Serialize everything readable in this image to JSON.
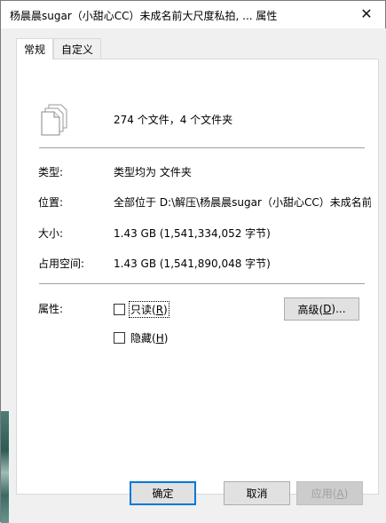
{
  "window": {
    "title": "杨晨晨sugar（小甜心CC）未成名前大尺度私拍, ... 属性",
    "close_symbol": "✕"
  },
  "tabs": [
    {
      "label": "常规",
      "active": true
    },
    {
      "label": "自定义",
      "active": false
    }
  ],
  "general": {
    "summary": "274 个文件，4 个文件夹",
    "type_label": "类型:",
    "type_value": "类型均为 文件夹",
    "location_label": "位置:",
    "location_value": "全部位于 D:\\解压\\杨晨晨sugar（小甜心CC）未成名前",
    "size_label": "大小:",
    "size_value": "1.43 GB (1,541,334,052 字节)",
    "disk_size_label": "占用空间:",
    "disk_size_value": "1.43 GB (1,541,890,048 字节)",
    "attributes_label": "属性:",
    "readonly": {
      "label_before": "只读(",
      "accel": "R",
      "label_after": ")",
      "checked": false
    },
    "hidden": {
      "label_before": "隐藏(",
      "accel": "H",
      "label_after": ")",
      "checked": false
    },
    "advanced_button": {
      "label_before": "高级(",
      "accel": "D",
      "label_after": ")..."
    }
  },
  "footer": {
    "ok_label": "确定",
    "cancel_label": "取消",
    "apply": {
      "label_before": "应用(",
      "accel": "A",
      "label_after": ")"
    }
  },
  "icons": {
    "files_icon": "stacked-documents-icon",
    "close_icon": "close-icon"
  },
  "colors": {
    "accent": "#0078d7",
    "window_bg": "#f0f0f0",
    "panel_bg": "#ffffff"
  }
}
